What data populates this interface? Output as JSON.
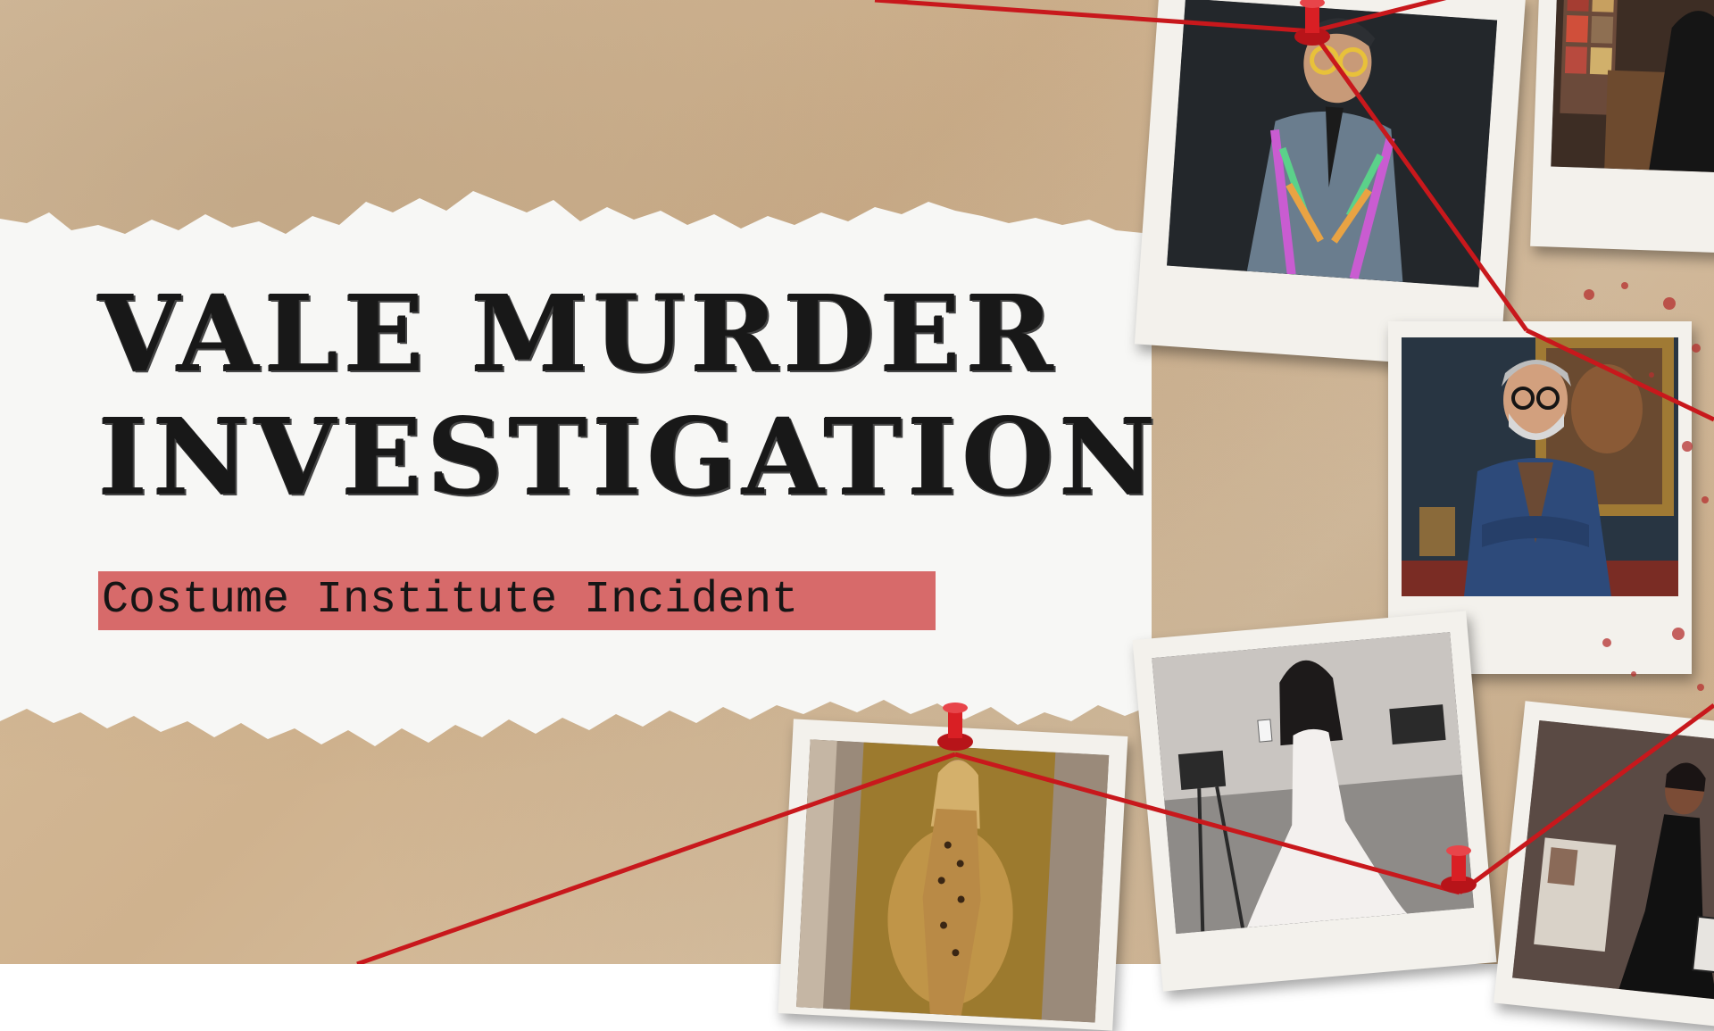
{
  "title": {
    "line1": "VALE MURDER",
    "line2": "INVESTIGATION"
  },
  "subtitle": "Costume Institute Incident",
  "colors": {
    "board": "#d3b894",
    "paper": "#f7f7f5",
    "subtitle_bg": "#d76a6a",
    "string": "#c8181c",
    "pin": "#d91f24",
    "title_text": "#181818"
  },
  "photos": [
    {
      "name": "suspect-sequin-suit-photo",
      "subject": "man in iridescent sequin suit with round glasses"
    },
    {
      "name": "suspect-dark-room-photo",
      "subject": "figure in black seated by framed posters"
    },
    {
      "name": "suspect-silver-haired-man-photo",
      "subject": "grey-haired bearded man in patterned blazer"
    },
    {
      "name": "suspect-white-gown-photo",
      "subject": "woman in white feathered gown holding phone among cameras"
    },
    {
      "name": "suspect-leopard-catsuit-photo",
      "subject": "blonde woman in leopard print catsuit"
    },
    {
      "name": "suspect-black-gown-photo",
      "subject": "woman in black gown holding sketchbook"
    }
  ]
}
